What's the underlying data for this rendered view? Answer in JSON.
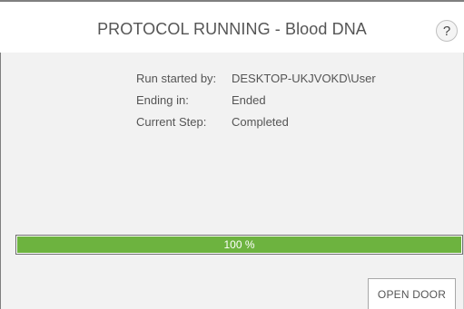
{
  "header": {
    "title": "PROTOCOL RUNNING - Blood DNA",
    "help_label": "?"
  },
  "info": {
    "rows": [
      {
        "label": "Run started by:",
        "value": "DESKTOP-UKJVOKD\\User"
      },
      {
        "label": "Ending in:",
        "value": "Ended"
      },
      {
        "label": "Current Step:",
        "value": "Completed"
      }
    ]
  },
  "progress": {
    "percent": 100,
    "label": "100 %",
    "fill_color": "#6db33f"
  },
  "actions": {
    "open_door_label": "OPEN DOOR"
  },
  "icons": {
    "help": "help-question-icon"
  }
}
